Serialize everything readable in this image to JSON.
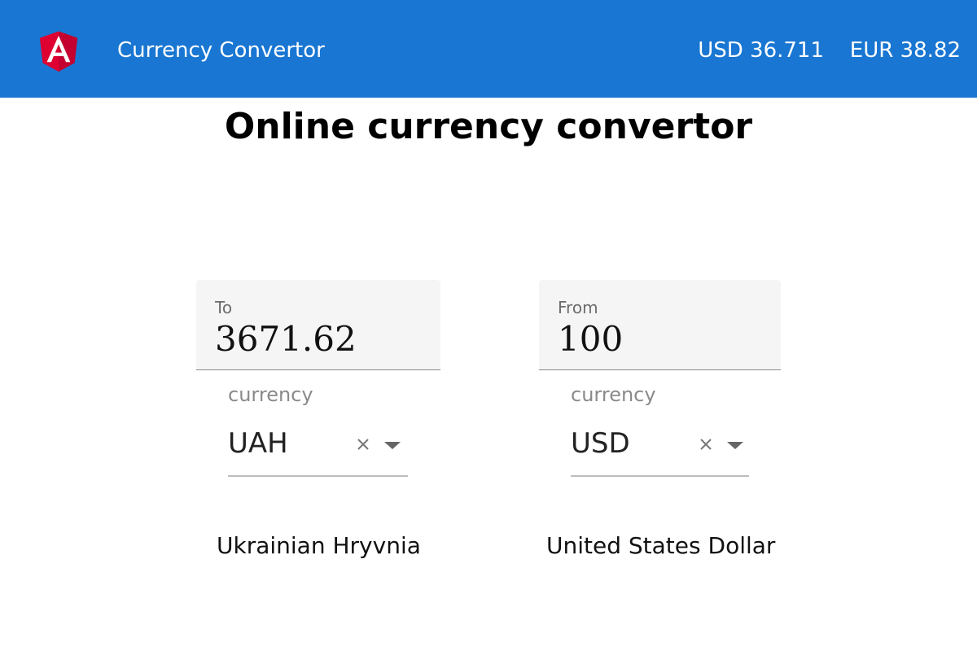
{
  "header": {
    "title": "Currency Convertor",
    "rates": {
      "usd": "USD 36.711",
      "eur": "EUR 38.82"
    },
    "colors": {
      "background": "#1976d2",
      "text": "#ffffff",
      "logo": "#dd0031"
    },
    "logo_icon": "angular-logo-icon"
  },
  "main": {
    "heading": "Online currency convertor",
    "converters": [
      {
        "amount_label": "To",
        "amount_value": "3671.62",
        "currency_label": "currency",
        "currency_value": "UAH",
        "currency_name": "Ukrainian Hryvnia"
      },
      {
        "amount_label": "From",
        "amount_value": "100",
        "currency_label": "currency",
        "currency_value": "USD",
        "currency_name": "United States Dollar"
      }
    ],
    "icons": {
      "clear": "close-icon",
      "dropdown": "caret-down-icon"
    }
  }
}
